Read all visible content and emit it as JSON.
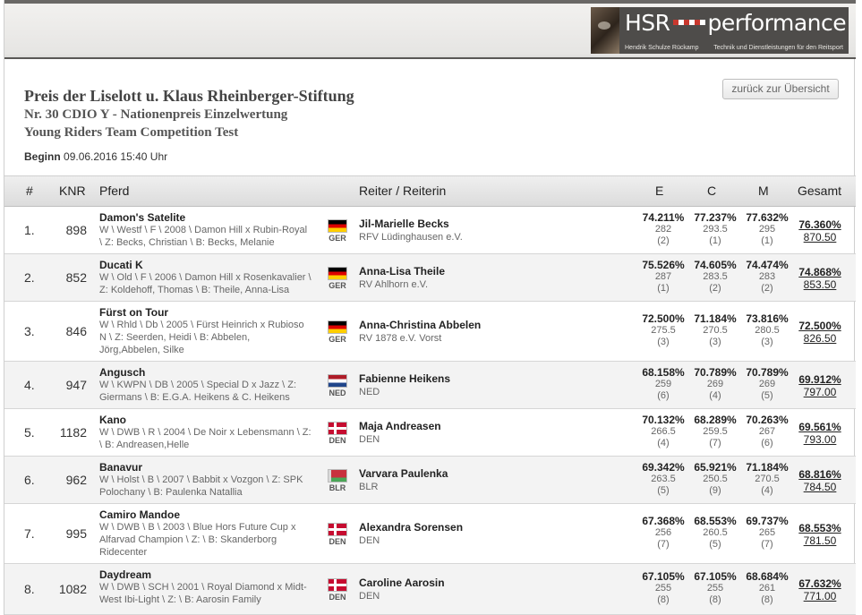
{
  "logo": {
    "brand_left": "HSR",
    "brand_right": "performance",
    "sub_left": "Hendrik Schulze Rückamp",
    "sub_right": "Technik und Dienstleistungen für den Reitsport"
  },
  "title": "Preis der Liselott u. Klaus Rheinberger-Stiftung",
  "subtitle": "Nr. 30 CDIO Y - Nationenpreis Einzelwertung",
  "subtitle2": "Young Riders Team Competition Test",
  "begin": {
    "label": "Beginn",
    "value": "09.06.2016 15:40 Uhr"
  },
  "back_button": "zurück zur Übersicht",
  "columns": {
    "rank": "#",
    "knr": "KNR",
    "horse": "Pferd",
    "rider": "Reiter / Reiterin",
    "e": "E",
    "c": "C",
    "m": "M",
    "total": "Gesamt"
  },
  "rows": [
    {
      "rank": "1.",
      "knr": "898",
      "horse": "Damon's Satelite",
      "horse_details": [
        "W \\ Westf \\ F \\ 2008 \\ Damon Hill x Rubin-Royal",
        "\\ Z: Becks, Christian \\ B: Becks, Melanie"
      ],
      "flag": "f-ger",
      "nation": "GER",
      "rider": "Jil-Marielle Becks",
      "club": "RFV Lüdinghausen e.V.",
      "e": {
        "pct": "74.211%",
        "pts": "282",
        "place": "(2)"
      },
      "c": {
        "pct": "77.237%",
        "pts": "293.5",
        "place": "(1)"
      },
      "m": {
        "pct": "77.632%",
        "pts": "295",
        "place": "(1)"
      },
      "total_pct": "76.360%",
      "total_pts": "870.50"
    },
    {
      "rank": "2.",
      "knr": "852",
      "horse": "Ducati K",
      "horse_details": [
        "W \\ Old \\ F \\ 2006 \\ Damon Hill x Rosenkavalier \\",
        "Z: Koldehoff, Thomas \\ B: Theile, Anna-Lisa"
      ],
      "flag": "f-ger",
      "nation": "GER",
      "rider": "Anna-Lisa Theile",
      "club": "RV Ahlhorn e.V.",
      "e": {
        "pct": "75.526%",
        "pts": "287",
        "place": "(1)"
      },
      "c": {
        "pct": "74.605%",
        "pts": "283.5",
        "place": "(2)"
      },
      "m": {
        "pct": "74.474%",
        "pts": "283",
        "place": "(2)"
      },
      "total_pct": "74.868%",
      "total_pts": "853.50"
    },
    {
      "rank": "3.",
      "knr": "846",
      "horse": "Fürst on Tour",
      "horse_details": [
        "W \\ Rhld \\ Db \\ 2005 \\ Fürst Heinrich x Rubioso",
        "N \\ Z: Seerden, Heidi \\ B: Abbelen,",
        "Jörg,Abbelen, Silke"
      ],
      "flag": "f-ger",
      "nation": "GER",
      "rider": "Anna-Christina Abbelen",
      "club": "RV 1878 e.V. Vorst",
      "e": {
        "pct": "72.500%",
        "pts": "275.5",
        "place": "(3)"
      },
      "c": {
        "pct": "71.184%",
        "pts": "270.5",
        "place": "(3)"
      },
      "m": {
        "pct": "73.816%",
        "pts": "280.5",
        "place": "(3)"
      },
      "total_pct": "72.500%",
      "total_pts": "826.50"
    },
    {
      "rank": "4.",
      "knr": "947",
      "horse": "Angusch",
      "horse_details": [
        "W \\ KWPN \\ DB \\ 2005 \\ Special D x Jazz \\ Z:",
        "Giermans \\ B: E.G.A. Heikens & C. Heikens"
      ],
      "flag": "f-ned",
      "nation": "NED",
      "rider": "Fabienne Heikens",
      "club": "NED",
      "e": {
        "pct": "68.158%",
        "pts": "259",
        "place": "(6)"
      },
      "c": {
        "pct": "70.789%",
        "pts": "269",
        "place": "(4)"
      },
      "m": {
        "pct": "70.789%",
        "pts": "269",
        "place": "(5)"
      },
      "total_pct": "69.912%",
      "total_pts": "797.00"
    },
    {
      "rank": "5.",
      "knr": "1182",
      "horse": "Kano",
      "horse_details": [
        "W \\ DWB \\ R \\ 2004 \\ De Noir x Lebensmann \\ Z:",
        "\\ B: Andreasen,Helle"
      ],
      "flag": "f-den",
      "nation": "DEN",
      "rider": "Maja Andreasen",
      "club": "DEN",
      "e": {
        "pct": "70.132%",
        "pts": "266.5",
        "place": "(4)"
      },
      "c": {
        "pct": "68.289%",
        "pts": "259.5",
        "place": "(7)"
      },
      "m": {
        "pct": "70.263%",
        "pts": "267",
        "place": "(6)"
      },
      "total_pct": "69.561%",
      "total_pts": "793.00"
    },
    {
      "rank": "6.",
      "knr": "962",
      "horse": "Banavur",
      "horse_details": [
        "W \\ Holst \\ B \\ 2007 \\ Babbit x Vozgon \\ Z: SPK",
        "Polochany \\ B: Paulenka Natallia"
      ],
      "flag": "f-blr",
      "nation": "BLR",
      "rider": "Varvara Paulenka",
      "club": "BLR",
      "e": {
        "pct": "69.342%",
        "pts": "263.5",
        "place": "(5)"
      },
      "c": {
        "pct": "65.921%",
        "pts": "250.5",
        "place": "(9)"
      },
      "m": {
        "pct": "71.184%",
        "pts": "270.5",
        "place": "(4)"
      },
      "total_pct": "68.816%",
      "total_pts": "784.50"
    },
    {
      "rank": "7.",
      "knr": "995",
      "horse": "Camiro Mandoe",
      "horse_details": [
        "W \\ DWB \\ B \\ 2003 \\ Blue Hors Future Cup x",
        "Alfarvad Champion \\ Z: \\ B: Skanderborg",
        "Ridecenter"
      ],
      "flag": "f-den",
      "nation": "DEN",
      "rider": "Alexandra Sorensen",
      "club": "DEN",
      "e": {
        "pct": "67.368%",
        "pts": "256",
        "place": "(7)"
      },
      "c": {
        "pct": "68.553%",
        "pts": "260.5",
        "place": "(5)"
      },
      "m": {
        "pct": "69.737%",
        "pts": "265",
        "place": "(7)"
      },
      "total_pct": "68.553%",
      "total_pts": "781.50"
    },
    {
      "rank": "8.",
      "knr": "1082",
      "horse": "Daydream",
      "horse_details": [
        "W \\ DWB \\ SCH \\ 2001 \\ Royal Diamond x Midt-",
        "West Ibi-Light \\ Z: \\ B: Aarosin Family"
      ],
      "flag": "f-den",
      "nation": "DEN",
      "rider": "Caroline Aarosin",
      "club": "DEN",
      "e": {
        "pct": "67.105%",
        "pts": "255",
        "place": "(8)"
      },
      "c": {
        "pct": "67.105%",
        "pts": "255",
        "place": "(8)"
      },
      "m": {
        "pct": "68.684%",
        "pts": "261",
        "place": "(8)"
      },
      "total_pct": "67.632%",
      "total_pts": "771.00"
    }
  ]
}
